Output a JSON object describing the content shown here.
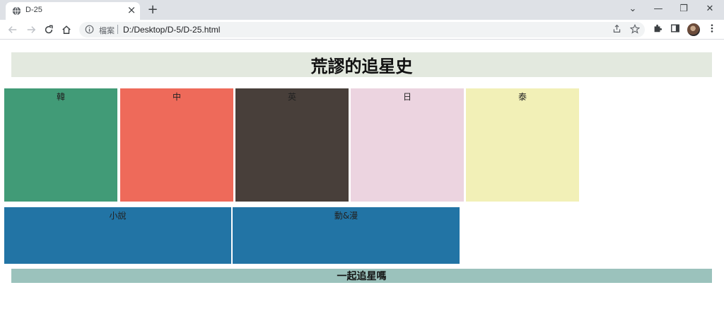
{
  "browser": {
    "tab_title": "D-25",
    "tab_close_glyph": "×",
    "new_tab_glyph": "+",
    "security_label": "檔案",
    "url": "D:/Desktop/D-5/D-25.html",
    "window_controls": {
      "menu": "⌄",
      "minimize": "—",
      "restore": "❐",
      "close": "✕"
    },
    "icons": {
      "back": "arrow-left-icon",
      "forward": "arrow-right-icon",
      "reload": "reload-icon",
      "home": "home-icon",
      "info": "info-icon",
      "share": "share-icon",
      "bookmark": "star-icon",
      "extensions": "puzzle-icon",
      "side_panel": "side-panel-icon",
      "menu": "kebab-menu-icon"
    }
  },
  "page": {
    "title": "荒謬的追星史",
    "languages": [
      {
        "label": "韓",
        "color": "#419b77"
      },
      {
        "label": "中",
        "color": "#ee6a5a"
      },
      {
        "label": "英",
        "color": "#483f3a"
      },
      {
        "label": "日",
        "color": "#ecd4e0"
      },
      {
        "label": "泰",
        "color": "#f2f0b7"
      }
    ],
    "categories": [
      {
        "label": "小說",
        "color": "#2274a5"
      },
      {
        "label": "動&漫",
        "color": "#2274a5"
      }
    ],
    "footer": "一起追星嗎"
  }
}
